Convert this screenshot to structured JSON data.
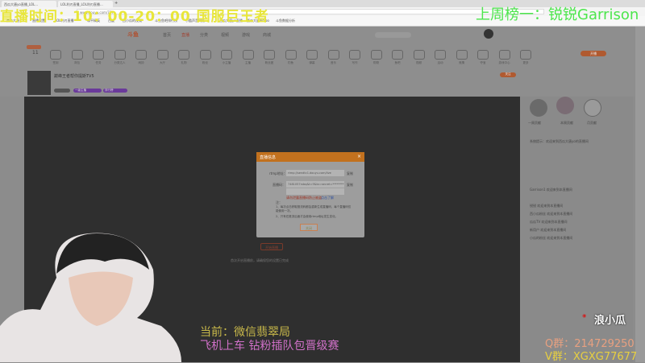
{
  "browser": {
    "tabs": [
      "西瓜大唐yo直播_LOL...",
      "LOL利刃直播_LOL利刃直播...",
      "+"
    ],
    "url": "www.douyu.com/777",
    "bookmarks": [
      "西瓜大唐",
      "直播设置",
      "LOL利刃直播",
      "和平精英",
      "百度",
      "西小瓜的视频",
      "斗鱼鱼吧排行榜",
      "小酷声音网红",
      "西瓜大唐yo直播",
      "西瓜大唐weibo",
      "斗鱼数据分析"
    ]
  },
  "overlay": {
    "live_time": "直播时间：10：00-20：00  国服巨王者",
    "rank": "上周榜一：锐锐Garrison",
    "current": "当前：微信翡翠局",
    "promo": "飞机上车 钻粉插队包晋级赛",
    "weibo": "浪小瓜",
    "qq": "Q群：214729250",
    "wx": "V群：XGXG77677"
  },
  "site": {
    "logo": "斗鱼",
    "nav": [
      "首页",
      "直播",
      "分类",
      "视频",
      "游戏",
      "商城"
    ],
    "icons": [
      "签到",
      "背包",
      "任务",
      "分类达人",
      "闹钟",
      "大厅",
      "礼物",
      "粉丝",
      "小主播",
      "主播",
      "粉丝团",
      "钓鱼",
      "弹幕",
      "音乐",
      "写作",
      "购物",
      "鱼吧",
      "视频",
      "活动",
      "竞猜",
      "夺宝",
      "游戏中心",
      "更多"
    ],
    "checkin_count": "11",
    "open_live": "开播",
    "room": {
      "title": "巅峰王者帮你提斯TV5",
      "follow": "关注",
      "tags": [
        "一级主播",
        "排行榜"
      ]
    }
  },
  "dialog": {
    "title": "直播信息",
    "rtmp_label": "rtmp地址：",
    "rtmp_value": "rtmp://sendtc1.douyu.com/live",
    "code_label": "直播码：",
    "code_value": "7481057rxbq&t=9&tx=secret=********",
    "copy": "复制",
    "warning": "请勿泄露直播码防止被盗",
    "help": "点击了解",
    "notes_title": "注：",
    "note1": "1、每次点击获取推流码都会重新生成直播码，每个直播码仅能使用一次。",
    "note2": "2、只有在推流后面才会使用rtmp地址发生变化。",
    "close": "关闭"
  },
  "video": {
    "start_button": "开始直播",
    "hint": "首次开启直播前，请确保您的设置已完成"
  },
  "sidebar": {
    "ranks": [
      "一周贡献",
      "本周贡献",
      "月贡献"
    ],
    "chat": [
      "系统提示：欢迎来到西瓜大唐yo的直播间",
      "Garrison1 欢迎来到本直播间",
      "锐锐 欢迎来到本直播间",
      "西小瓜粉丝 欢迎来到本直播间",
      "瓜瓜TV 欢迎来到本直播间",
      "新用户 欢迎来到本直播间",
      "小瓜的粉丝 欢迎来到本直播间"
    ]
  }
}
